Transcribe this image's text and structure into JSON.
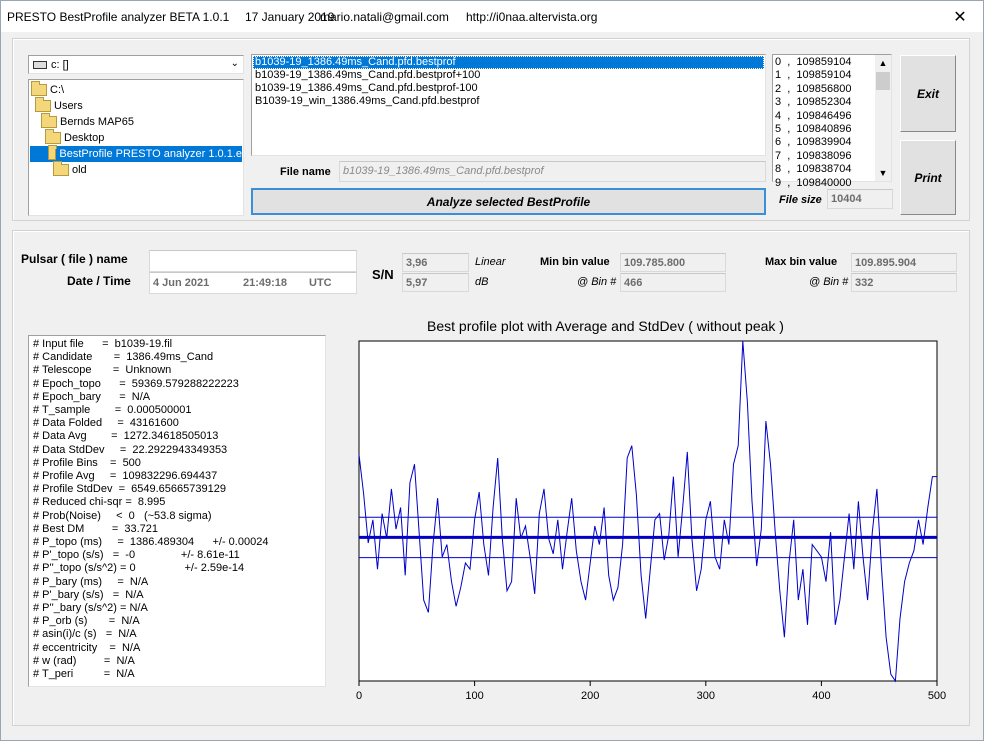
{
  "window": {
    "title": "PRESTO BestProfile analyzer BETA 1.0.1",
    "date": "17 January 2019",
    "email": "mario.natali@gmail.com",
    "url": "http://i0naa.altervista.org",
    "close_glyph": "✕"
  },
  "drive": {
    "value": "c: []"
  },
  "folders": [
    {
      "label": "C:\\",
      "selected": false
    },
    {
      "label": "Users",
      "selected": false
    },
    {
      "label": "Bernds MAP65",
      "selected": false
    },
    {
      "label": "Desktop",
      "selected": false
    },
    {
      "label": "BestProfile PRESTO analyzer 1.0.1.e",
      "selected": true
    },
    {
      "label": "old",
      "selected": false
    }
  ],
  "files": [
    "b1039-19_1386.49ms_Cand.pfd.bestprof",
    "b1039-19_1386.49ms_Cand.pfd.bestprof+100",
    "b1039-19_1386.49ms_Cand.pfd.bestprof-100",
    "B1039-19_win_1386.49ms_Cand.pfd.bestprof"
  ],
  "values_list": [
    "0  ,  109859104",
    "1  ,  109859104",
    "2  ,  109856800",
    "3  ,  109852304",
    "4  ,  109846496",
    "5  ,  109840896",
    "6  ,  109839904",
    "7  ,  109838096",
    "8  ,  109838704",
    "9  ,  109840000"
  ],
  "buttons": {
    "exit": "Exit",
    "print": "Print",
    "analyze": "Analyze selected BestProfile"
  },
  "file_name": {
    "label": "File name",
    "value": "b1039-19_1386.49ms_Cand.pfd.bestprof"
  },
  "file_size": {
    "label": "File size",
    "value": "10404"
  },
  "pulsar": {
    "label": "Pulsar ( file ) name",
    "value": ""
  },
  "datetime": {
    "label": "Date / Time",
    "date": "4 Jun 2021",
    "time": "21:49:18",
    "tz": "UTC"
  },
  "sn": {
    "label": "S/N",
    "linear_value": "3,96",
    "linear_unit": "Linear",
    "db_value": "5,97",
    "db_unit": "dB"
  },
  "min_bin": {
    "label": "Min bin value",
    "value": "109.785.800",
    "bin_label": "@ Bin #",
    "bin": "466"
  },
  "max_bin": {
    "label": "Max bin value",
    "value": "109.895.904",
    "bin_label": "@ Bin #",
    "bin": "332"
  },
  "info_lines": [
    "# Input file      =  b1039-19.fil",
    "# Candidate       =  1386.49ms_Cand",
    "# Telescope       =  Unknown",
    "# Epoch_topo      =  59369.579288222223",
    "# Epoch_bary      =  N/A",
    "# T_sample        =  0.000500001",
    "# Data Folded     =  43161600",
    "# Data Avg        =  1272.34618505013",
    "# Data StdDev     =  22.2922943349353",
    "# Profile Bins    =  500",
    "# Profile Avg     =  109832296.694437",
    "# Profile StdDev  =  6549.65665739129",
    "# Reduced chi-sqr =  8.995",
    "# Prob(Noise)     <  0   (~53.8 sigma)",
    "# Best DM         =  33.721",
    "# P_topo (ms)     =  1386.489304      +/- 0.00024",
    "# P'_topo (s/s)   =  -0               +/- 8.61e-11",
    "# P''_topo (s/s^2) = 0                +/- 2.59e-14",
    "# P_bary (ms)     =  N/A",
    "# P'_bary (s/s)   =  N/A",
    "# P''_bary (s/s^2) = N/A",
    "# P_orb (s)       =  N/A",
    "# asin(i)/c (s)   =  N/A",
    "# eccentricity    =  N/A",
    "# w (rad)         =  N/A",
    "# T_peri          =  N/A"
  ],
  "chart_data": {
    "type": "line",
    "title": "Best profile plot with  Average and StdDev ( without peak )",
    "xlim": [
      0,
      500
    ],
    "x_ticks": [
      0,
      100,
      200,
      300,
      400,
      500
    ],
    "average": 109832296.694437,
    "stddev": 6549.65665739129,
    "ylim": [
      109785800,
      109895904
    ],
    "line_color": "#0000c8",
    "grid": false,
    "series": [
      {
        "x": [
          0,
          4,
          8,
          12,
          16,
          20,
          24,
          28,
          32,
          36,
          40,
          44,
          48,
          52,
          56,
          60,
          64,
          68,
          72,
          76,
          80,
          84,
          88,
          92,
          96,
          100,
          104,
          108,
          112,
          116,
          120,
          124,
          128,
          132,
          136,
          140,
          144,
          148,
          152,
          156,
          160,
          164,
          168,
          172,
          176,
          180,
          184,
          188,
          192,
          196,
          200,
          204,
          208,
          212,
          216,
          220,
          224,
          228,
          232,
          236,
          240,
          244,
          248,
          252,
          256,
          260,
          264,
          268,
          272,
          276,
          280,
          284,
          288,
          292,
          296,
          300,
          304,
          308,
          312,
          316,
          320,
          324,
          328,
          332,
          336,
          340,
          344,
          348,
          352,
          356,
          360,
          364,
          368,
          372,
          376,
          380,
          384,
          388,
          392,
          396,
          400,
          404,
          408,
          412,
          416,
          420,
          424,
          428,
          432,
          436,
          440,
          444,
          448,
          452,
          456,
          460,
          464,
          468,
          472,
          476,
          480,
          484,
          488,
          492,
          496,
          500
        ],
        "y": [
          109859104,
          109846496,
          109830500,
          109838000,
          109822000,
          109840000,
          109832000,
          109848000,
          109835000,
          109842000,
          109820000,
          109850000,
          109856000,
          109834000,
          109812000,
          109808000,
          109830000,
          109845000,
          109826000,
          109830000,
          109818000,
          109810000,
          109816000,
          109824000,
          109822000,
          109838000,
          109847000,
          109830000,
          109820000,
          109842000,
          109858000,
          109832000,
          109815000,
          109818000,
          109845000,
          109832000,
          109836000,
          109826000,
          109814000,
          109840000,
          109848000,
          109832000,
          109827000,
          109838000,
          109822000,
          109834000,
          109845000,
          109828000,
          109818000,
          109812000,
          109824000,
          109836000,
          109830000,
          109842000,
          109820000,
          109812000,
          109816000,
          109830000,
          109858000,
          109862000,
          109846000,
          109820000,
          109806000,
          109822000,
          109838000,
          109840000,
          109825000,
          109833000,
          109852000,
          109826000,
          109842000,
          109860000,
          109832000,
          109815000,
          109822000,
          109838000,
          109844000,
          109826000,
          109822000,
          109838000,
          109830000,
          109856000,
          109862000,
          109895904,
          109876000,
          109844000,
          109823000,
          109835000,
          109870000,
          109856000,
          109834000,
          109815000,
          109800000,
          109824000,
          109838000,
          109812000,
          109822000,
          109804000,
          109830000,
          109828000,
          109826000,
          109818000,
          109834000,
          109804000,
          109812000,
          109826000,
          109840000,
          109822000,
          109844000,
          109826000,
          109812000,
          109834000,
          109848000,
          109822000,
          109800000,
          109788000,
          109785800,
          109806000,
          109818000,
          109824000,
          109828000,
          109838000,
          109830000,
          109842000,
          109852000,
          109852000
        ]
      }
    ]
  }
}
